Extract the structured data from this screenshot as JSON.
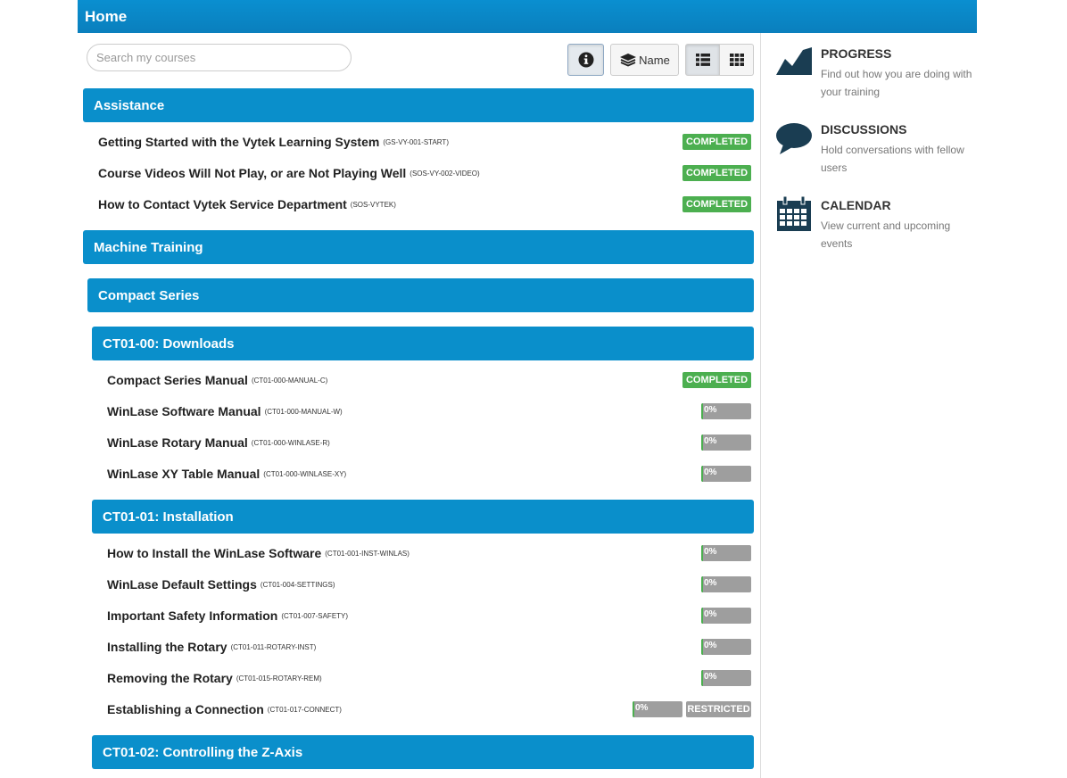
{
  "header": {
    "title": "Home"
  },
  "toolbar": {
    "search_placeholder": "Search my courses",
    "info_icon": "info-circle-icon",
    "sort_label": "Name",
    "sort_icon": "layers-icon",
    "view_list_icon": "list-view-icon",
    "view_grid_icon": "grid-view-icon"
  },
  "categories": [
    {
      "label": "Assistance"
    },
    {
      "label": "Machine Training"
    },
    {
      "label": "Compact Series"
    },
    {
      "label": "CT01-00: Downloads"
    },
    {
      "label": "CT01-01: Installation"
    },
    {
      "label": "CT01-02: Controlling the Z-Axis"
    }
  ],
  "courses": [
    {
      "title": "Getting Started with the Vytek Learning System",
      "code": "(GS-VY-001-START)",
      "status": "COMPLETED"
    },
    {
      "title": "Course Videos Will Not Play, or are Not Playing Well",
      "code": "(SOS-VY-002-VIDEO)",
      "status": "COMPLETED"
    },
    {
      "title": "How to Contact Vytek Service Department",
      "code": "(SOS-VYTEK)",
      "status": "COMPLETED"
    },
    {
      "title": "Compact Series Manual",
      "code": "(CT01-000-MANUAL-C)",
      "status": "COMPLETED"
    },
    {
      "title": "WinLase Software Manual",
      "code": "(CT01-000-MANUAL-W)",
      "progress": "0%"
    },
    {
      "title": "WinLase Rotary Manual",
      "code": "(CT01-000-WINLASE-R)",
      "progress": "0%"
    },
    {
      "title": "WinLase XY Table Manual",
      "code": "(CT01-000-WINLASE-XY)",
      "progress": "0%"
    },
    {
      "title": "How to Install the WinLase Software",
      "code": "(CT01-001-INST-WINLAS)",
      "progress": "0%"
    },
    {
      "title": "WinLase Default Settings",
      "code": "(CT01-004-SETTINGS)",
      "progress": "0%"
    },
    {
      "title": "Important Safety Information",
      "code": "(CT01-007-SAFETY)",
      "progress": "0%"
    },
    {
      "title": "Installing the Rotary",
      "code": "(CT01-011-ROTARY-INST)",
      "progress": "0%"
    },
    {
      "title": "Removing the Rotary",
      "code": "(CT01-015-ROTARY-REM)",
      "progress": "0%"
    },
    {
      "title": "Establishing a Connection",
      "code": "(CT01-017-CONNECT)",
      "progress": "0%",
      "status": "RESTRICTED"
    }
  ],
  "sidebar": {
    "items": [
      {
        "title": "PROGRESS",
        "desc": "Find out how you are doing with your training",
        "icon": "chart-icon"
      },
      {
        "title": "DISCUSSIONS",
        "desc": "Hold conversations with fellow users",
        "icon": "speech-bubble-icon"
      },
      {
        "title": "CALENDAR",
        "desc": "View current and upcoming events",
        "icon": "calendar-icon"
      }
    ]
  },
  "colors": {
    "primary": "#0a8fcb",
    "success": "#4caf50",
    "muted": "#9e9e9e",
    "icon": "#1a3d52"
  }
}
